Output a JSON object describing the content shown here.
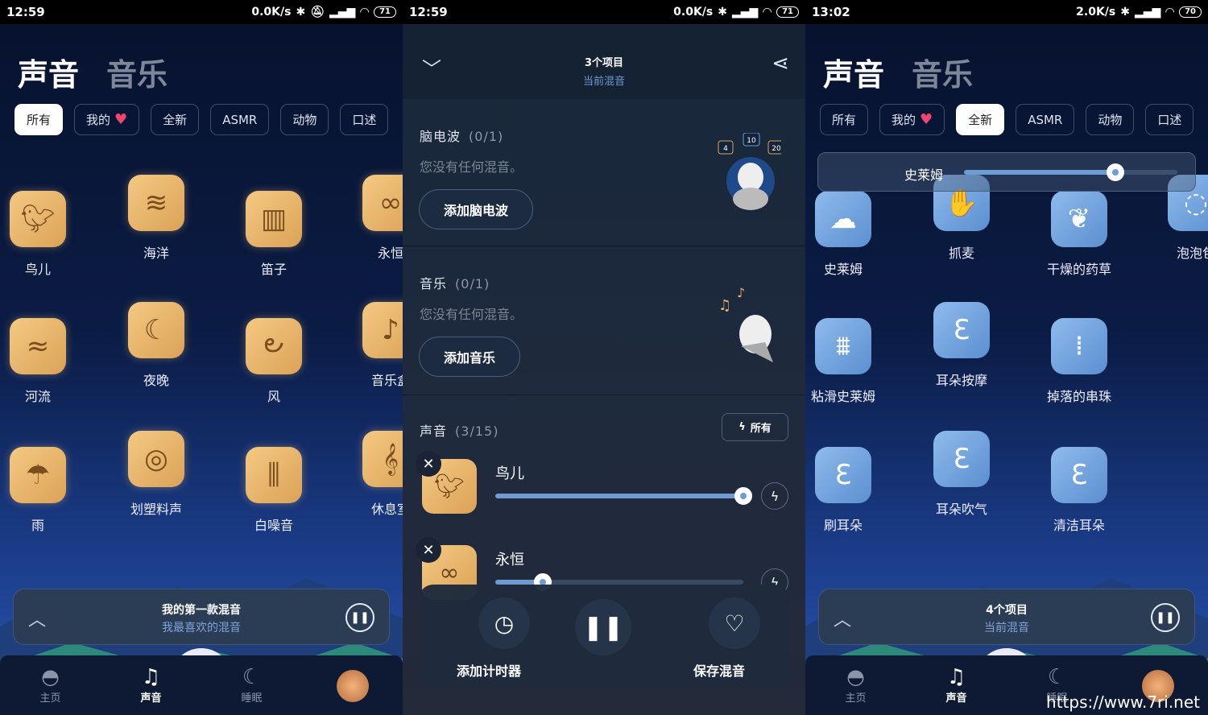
{
  "screens": [
    {
      "status": {
        "time": "12:59",
        "speed": "0.0K/s",
        "battery": "71"
      },
      "tabs": [
        "声音",
        "音乐"
      ],
      "filters": [
        "所有",
        "我的",
        "全新",
        "ASMR",
        "动物",
        "口述"
      ],
      "active_filter": 0,
      "sounds": [
        "鸟儿",
        "海洋",
        "笛子",
        "永恒",
        "河流",
        "夜晚",
        "风",
        "音乐盒",
        "雨",
        "划塑料声",
        "白噪音",
        "休息室"
      ],
      "sound_icons": [
        "bird-icon",
        "ocean-icon",
        "flute-icon",
        "infinity-icon",
        "river-icon",
        "moon-icon",
        "wind-icon",
        "music-box-icon",
        "rain-icon",
        "plastic-icon",
        "white-noise-icon",
        "treble-clef-icon"
      ],
      "mini_player": {
        "title": "我的第一款混音",
        "subtitle": "我最喜欢的混音"
      },
      "nav": [
        "主页",
        "声音",
        "睡眠"
      ]
    },
    {
      "status": {
        "time": "12:59",
        "speed": "0.0K/s",
        "battery": "71"
      },
      "header": {
        "title": "3个项目",
        "subtitle": "当前混音"
      },
      "brainwave": {
        "label": "脑电波",
        "count": "(0/1)",
        "empty": "您没有任何混音。",
        "button": "添加脑电波",
        "badges": [
          "4",
          "10",
          "20"
        ]
      },
      "music": {
        "label": "音乐",
        "count": "(0/1)",
        "empty": "您没有任何混音。",
        "button": "添加音乐"
      },
      "sounds": {
        "label": "声音",
        "count": "(3/15)",
        "all_button": "所有",
        "items": [
          {
            "name": "鸟儿",
            "volume": 1.0
          },
          {
            "name": "永恒",
            "volume": 0.19
          }
        ]
      },
      "controls": {
        "timer": "添加计时器",
        "save": "保存混音"
      }
    },
    {
      "status": {
        "time": "13:02",
        "speed": "2.0K/s",
        "battery": "70"
      },
      "tabs": [
        "声音",
        "音乐"
      ],
      "filters": [
        "所有",
        "我的",
        "全新",
        "ASMR",
        "动物",
        "口述"
      ],
      "active_filter": 2,
      "volume_popup": {
        "name": "史莱姆",
        "volume": 0.71
      },
      "sounds": [
        "史莱姆",
        "抓麦",
        "干燥的药草",
        "泡泡包",
        "粘滑史莱姆",
        "耳朵按摩",
        "掉落的串珠",
        "",
        "刷耳朵",
        "耳朵吹气",
        "清洁耳朵",
        ""
      ],
      "sound_icons": [
        "slime-icon",
        "grab-mic-icon",
        "herbs-icon",
        "bubble-wrap-icon",
        "slippery-slime-icon",
        "ear-massage-icon",
        "beads-icon",
        "",
        "brush-ear-icon",
        "ear-blow-icon",
        "clean-ear-icon",
        ""
      ],
      "mini_player": {
        "title": "4个项目",
        "subtitle": "当前混音"
      },
      "nav": [
        "主页",
        "声音",
        "睡眠"
      ],
      "watermark": "https://www.7ri.net"
    }
  ],
  "colors": {
    "accent": "#6f9bd3",
    "heart": "#f0456f",
    "wood": "#e9b466",
    "asmr_tile": "#6fa3dc"
  }
}
